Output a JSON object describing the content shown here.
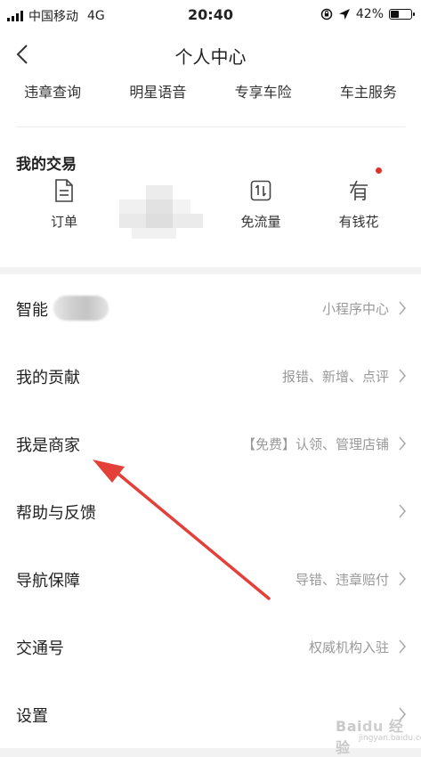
{
  "status_bar": {
    "carrier": "中国移动",
    "network": "4G",
    "time": "20:40",
    "battery": "42%",
    "battery_level": 0.42
  },
  "nav": {
    "title": "个人中心",
    "back_icon": "chevron-left-icon"
  },
  "services": [
    "违章查询",
    "明星语音",
    "专享车险",
    "车主服务"
  ],
  "trade": {
    "title": "我的交易",
    "items": [
      {
        "label": "订单",
        "icon": "document-icon"
      },
      {
        "label": "免流量",
        "icon": "data-transfer-icon"
      },
      {
        "label": "有钱花",
        "icon": "money-icon"
      }
    ]
  },
  "menu": [
    {
      "label": "智能",
      "sub": "小程序中心"
    },
    {
      "label": "我的贡献",
      "sub": "报错、新增、点评"
    },
    {
      "label": "我是商家",
      "sub": "【免费】认领、管理店铺"
    },
    {
      "label": "帮助与反馈",
      "sub": ""
    },
    {
      "label": "导航保障",
      "sub": "导错、违章赔付"
    },
    {
      "label": "交通号",
      "sub": "权威机构入驻"
    },
    {
      "label": "设置",
      "sub": ""
    }
  ],
  "colors": {
    "accent_red": "#e0322b",
    "text_secondary": "#999999"
  }
}
